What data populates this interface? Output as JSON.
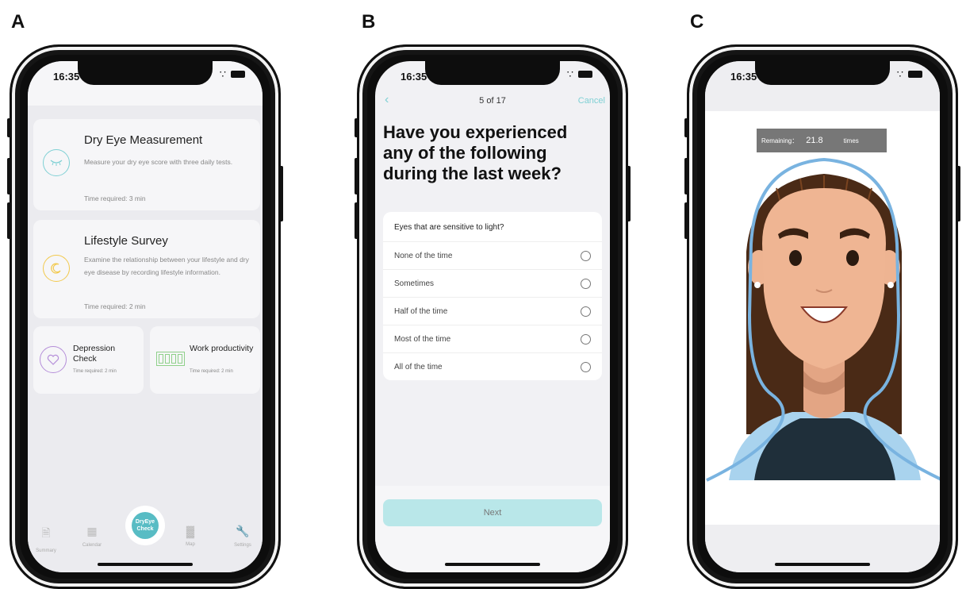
{
  "panels": {
    "a": {
      "letter": "A"
    },
    "b": {
      "letter": "B"
    },
    "c": {
      "letter": "C"
    }
  },
  "status": {
    "time_a": "16:35",
    "time_b": "16:35",
    "time_c": "16:35"
  },
  "screen_a": {
    "cards": [
      {
        "title": "Dry Eye Measurement",
        "desc": "Measure your dry eye score with three daily tests.",
        "time": "Time required: 3 min",
        "icon": "closed-eye-icon",
        "color": "#7fd0d4"
      },
      {
        "title": "Lifestyle Survey",
        "desc": "Examine the relationship between your lifestyle and dry eye disease by recording lifestyle information.",
        "time": "Time required: 2 min",
        "icon": "moon-icon",
        "color": "#f2c94c"
      }
    ],
    "small_cards": [
      {
        "title": "Depression Check",
        "time": "Time required: 2 min",
        "icon": "heart-icon",
        "color": "#b58ed9"
      },
      {
        "title": "Work productivity",
        "time": "Time required: 2 min",
        "icon": "battery-icon",
        "color": "#8fd08a"
      }
    ],
    "tabs": {
      "summary": "Summary",
      "calendar": "Calendar",
      "center": "DryEye Check",
      "map": "Map",
      "settings": "Settings"
    }
  },
  "screen_b": {
    "progress": "5 of 17",
    "cancel": "Cancel",
    "question": "Have you experienced any of the following during the last week?",
    "item": "Eyes that are sensitive to light?",
    "options": [
      "None of the time",
      "Sometimes",
      "Half of the time",
      "Most of the time",
      "All of the time"
    ],
    "next": "Next"
  },
  "screen_c": {
    "remaining_label": "Remaining：",
    "remaining_value": "21.8",
    "remaining_unit": "times"
  }
}
